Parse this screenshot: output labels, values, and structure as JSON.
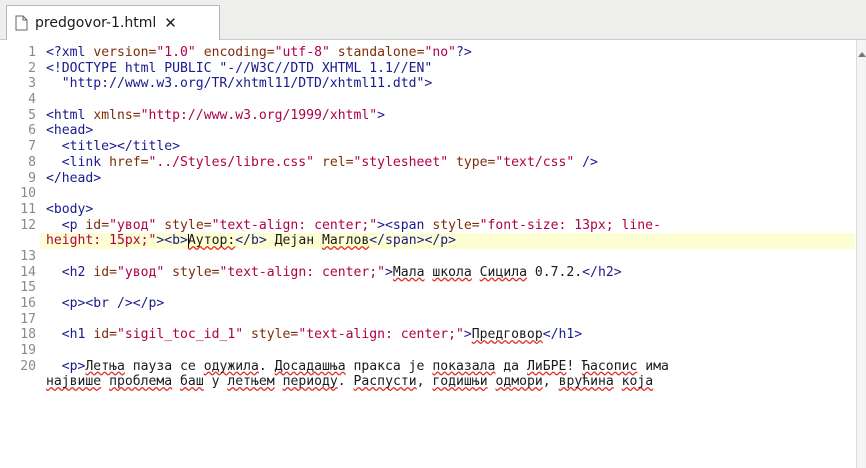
{
  "tab": {
    "label": "predgovor-1.html",
    "close_glyph": "✕",
    "icon": "file-icon"
  },
  "lines": [
    {
      "n": "1",
      "tokens": [
        {
          "c": "t",
          "v": "<?xml "
        },
        {
          "c": "a",
          "v": "version="
        },
        {
          "c": "s",
          "v": "\"1.0\""
        },
        {
          "c": "x",
          "v": " "
        },
        {
          "c": "a",
          "v": "encoding="
        },
        {
          "c": "s",
          "v": "\"utf-8\""
        },
        {
          "c": "x",
          "v": " "
        },
        {
          "c": "a",
          "v": "standalone="
        },
        {
          "c": "s",
          "v": "\"no\""
        },
        {
          "c": "t",
          "v": "?>"
        }
      ]
    },
    {
      "n": "2",
      "tokens": [
        {
          "c": "t",
          "v": "<!DOCTYPE html PUBLIC \"-//W3C//DTD XHTML 1.1//EN\""
        }
      ]
    },
    {
      "n": "3",
      "tokens": [
        {
          "c": "t",
          "v": "  \"http://www.w3.org/TR/xhtml11/DTD/xhtml11.dtd\">"
        }
      ]
    },
    {
      "n": "4",
      "tokens": []
    },
    {
      "n": "5",
      "tokens": [
        {
          "c": "t",
          "v": "<html "
        },
        {
          "c": "a",
          "v": "xmlns="
        },
        {
          "c": "s",
          "v": "\"http://www.w3.org/1999/xhtml\""
        },
        {
          "c": "t",
          "v": ">"
        }
      ]
    },
    {
      "n": "6",
      "tokens": [
        {
          "c": "t",
          "v": "<head>"
        }
      ]
    },
    {
      "n": "7",
      "tokens": [
        {
          "c": "t",
          "v": "  <title></title>"
        }
      ]
    },
    {
      "n": "8",
      "tokens": [
        {
          "c": "t",
          "v": "  <link "
        },
        {
          "c": "a",
          "v": "href="
        },
        {
          "c": "s",
          "v": "\"../Styles/libre.css\""
        },
        {
          "c": "x",
          "v": " "
        },
        {
          "c": "a",
          "v": "rel="
        },
        {
          "c": "s",
          "v": "\"stylesheet\""
        },
        {
          "c": "x",
          "v": " "
        },
        {
          "c": "a",
          "v": "type="
        },
        {
          "c": "s",
          "v": "\"text/css\""
        },
        {
          "c": "t",
          "v": " />"
        }
      ]
    },
    {
      "n": "9",
      "tokens": [
        {
          "c": "t",
          "v": "</head>"
        }
      ]
    },
    {
      "n": "10",
      "tokens": []
    },
    {
      "n": "11",
      "tokens": [
        {
          "c": "t",
          "v": "<body>"
        }
      ]
    },
    {
      "n": "12",
      "tokens": [
        {
          "c": "t",
          "v": "  <p "
        },
        {
          "c": "a",
          "v": "id="
        },
        {
          "c": "s",
          "v": "\"увод\""
        },
        {
          "c": "x",
          "v": " "
        },
        {
          "c": "a",
          "v": "style="
        },
        {
          "c": "s",
          "v": "\"text-align: center;\""
        },
        {
          "c": "t",
          "v": "><span "
        },
        {
          "c": "a",
          "v": "style="
        },
        {
          "c": "s",
          "v": "\"font-size: 13px; line-"
        }
      ]
    },
    {
      "n": "",
      "highlight": true,
      "tokens": [
        {
          "c": "s",
          "v": "height: 15px;\""
        },
        {
          "c": "t",
          "v": "><b>"
        },
        {
          "c": "caret",
          "v": ""
        },
        {
          "c": "x",
          "v": "Аутор:",
          "sq": true
        },
        {
          "c": "t",
          "v": "</b>"
        },
        {
          "c": "x",
          "v": " Дејан ",
          "sq": false
        },
        {
          "c": "x",
          "v": "Маглов",
          "sq": true
        },
        {
          "c": "t",
          "v": "</span></p>"
        }
      ]
    },
    {
      "n": "13",
      "tokens": []
    },
    {
      "n": "14",
      "tokens": [
        {
          "c": "t",
          "v": "  <h2 "
        },
        {
          "c": "a",
          "v": "id="
        },
        {
          "c": "s",
          "v": "\"увод\""
        },
        {
          "c": "x",
          "v": " "
        },
        {
          "c": "a",
          "v": "style="
        },
        {
          "c": "s",
          "v": "\"text-align: center;\""
        },
        {
          "c": "t",
          "v": ">"
        },
        {
          "c": "x",
          "v": "Мала",
          "sq": true
        },
        {
          "c": "x",
          "v": " "
        },
        {
          "c": "x",
          "v": "школа",
          "sq": true
        },
        {
          "c": "x",
          "v": " "
        },
        {
          "c": "x",
          "v": "Сицила",
          "sq": true
        },
        {
          "c": "x",
          "v": " 0.7.2."
        },
        {
          "c": "t",
          "v": "</h2>"
        }
      ]
    },
    {
      "n": "15",
      "tokens": []
    },
    {
      "n": "16",
      "tokens": [
        {
          "c": "t",
          "v": "  <p><br /></p>"
        }
      ]
    },
    {
      "n": "17",
      "tokens": []
    },
    {
      "n": "18",
      "tokens": [
        {
          "c": "t",
          "v": "  <h1 "
        },
        {
          "c": "a",
          "v": "id="
        },
        {
          "c": "s",
          "v": "\"sigil_toc_id_1\""
        },
        {
          "c": "x",
          "v": " "
        },
        {
          "c": "a",
          "v": "style="
        },
        {
          "c": "s",
          "v": "\"text-align: center;\""
        },
        {
          "c": "t",
          "v": ">"
        },
        {
          "c": "x",
          "v": "Предговор",
          "sq": true
        },
        {
          "c": "t",
          "v": "</h1>"
        }
      ]
    },
    {
      "n": "19",
      "tokens": []
    },
    {
      "n": "20",
      "tokens": [
        {
          "c": "t",
          "v": "  <p>"
        },
        {
          "c": "x",
          "v": "Летња",
          "sq": true
        },
        {
          "c": "x",
          "v": " пауза се "
        },
        {
          "c": "x",
          "v": "одужила",
          "sq": true
        },
        {
          "c": "x",
          "v": ". "
        },
        {
          "c": "x",
          "v": "Досадашња",
          "sq": true
        },
        {
          "c": "x",
          "v": " пракса је "
        },
        {
          "c": "x",
          "v": "показала",
          "sq": true
        },
        {
          "c": "x",
          "v": " да "
        },
        {
          "c": "x",
          "v": "ЛиБРЕ",
          "sq": true
        },
        {
          "c": "x",
          "v": "! "
        },
        {
          "c": "x",
          "v": "Ћасопис",
          "sq": true
        },
        {
          "c": "x",
          "v": " има"
        }
      ]
    },
    {
      "n": "",
      "tokens": [
        {
          "c": "x",
          "v": "највише",
          "sq": true
        },
        {
          "c": "x",
          "v": " "
        },
        {
          "c": "x",
          "v": "проблема",
          "sq": true
        },
        {
          "c": "x",
          "v": " "
        },
        {
          "c": "x",
          "v": "баш",
          "sq": true
        },
        {
          "c": "x",
          "v": " у "
        },
        {
          "c": "x",
          "v": "летњем",
          "sq": true
        },
        {
          "c": "x",
          "v": " "
        },
        {
          "c": "x",
          "v": "периоду",
          "sq": true
        },
        {
          "c": "x",
          "v": ". "
        },
        {
          "c": "x",
          "v": "Распусти",
          "sq": true
        },
        {
          "c": "x",
          "v": ", "
        },
        {
          "c": "x",
          "v": "годишњи",
          "sq": true
        },
        {
          "c": "x",
          "v": " "
        },
        {
          "c": "x",
          "v": "одмори",
          "sq": true
        },
        {
          "c": "x",
          "v": ", "
        },
        {
          "c": "x",
          "v": "врућина",
          "sq": true
        },
        {
          "c": "x",
          "v": " "
        },
        {
          "c": "x",
          "v": "која",
          "sq": true
        }
      ]
    }
  ]
}
